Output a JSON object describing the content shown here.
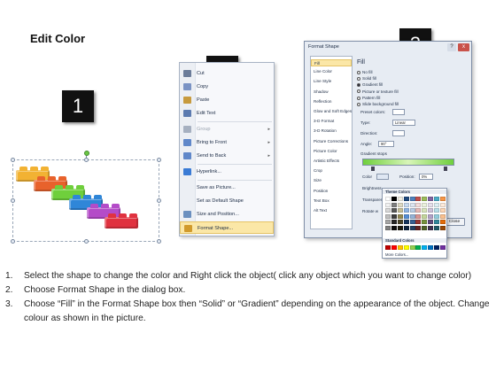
{
  "title": "Edit Color",
  "badges": [
    "1",
    "2",
    "3"
  ],
  "colors": {
    "bricks": [
      "#f2b233",
      "#e8622c",
      "#6fcf3c",
      "#2f86d8",
      "#b44cc8",
      "#e0323f"
    ]
  },
  "context_menu": {
    "items": [
      {
        "label": "Cut",
        "icon": "scissors-icon",
        "disabled": false
      },
      {
        "label": "Copy",
        "icon": "copy-icon",
        "disabled": false
      },
      {
        "label": "Paste",
        "icon": "paste-icon",
        "disabled": false
      },
      {
        "label": "Edit Text",
        "icon": "edit-text-icon",
        "disabled": false
      },
      {
        "label": "Group",
        "icon": "group-icon",
        "disabled": true,
        "submenu": true
      },
      {
        "label": "Bring to Front",
        "icon": "bring-front-icon",
        "disabled": false,
        "submenu": true
      },
      {
        "label": "Send to Back",
        "icon": "send-back-icon",
        "disabled": false,
        "submenu": true
      },
      {
        "label": "Hyperlink...",
        "icon": "hyperlink-icon",
        "disabled": false
      },
      {
        "label": "Save as Picture...",
        "icon": "",
        "disabled": false
      },
      {
        "label": "Set as Default Shape",
        "icon": "",
        "disabled": false
      },
      {
        "label": "Size and Position...",
        "icon": "size-icon",
        "disabled": false
      },
      {
        "label": "Format Shape...",
        "icon": "format-icon",
        "disabled": false,
        "highlighted": true
      }
    ]
  },
  "dialog": {
    "title": "Format Shape",
    "close": "x",
    "help": "?",
    "left_items": [
      "Fill",
      "Line Color",
      "Line Style",
      "Shadow",
      "Reflection",
      "Glow and Soft Edges",
      "3-D Format",
      "3-D Rotation",
      "Picture Corrections",
      "Picture Color",
      "Artistic Effects",
      "Crop",
      "Size",
      "Position",
      "Text Box",
      "Alt Text"
    ],
    "fill_heading": "Fill",
    "options": [
      "No fill",
      "Solid fill",
      "Gradient fill",
      "Picture or texture fill",
      "Pattern fill",
      "Slide background fill"
    ],
    "selected_option": "Gradient fill",
    "preset_label": "Preset colors:",
    "type_label": "Type:",
    "type_value": "Linear",
    "direction_label": "Direction:",
    "angle_label": "Angle:",
    "angle_value": "90°",
    "stops_label": "Gradient stops",
    "color_label": "Color",
    "position_label": "Position:",
    "position_value": "0%",
    "brightness_label": "Brightness",
    "transparency_label": "Transparen",
    "rotate_label": "Rotate w",
    "close_button": "Close"
  },
  "palette": {
    "theme_heading": "Theme Colors",
    "standard_heading": "Standard Colors",
    "more": "More Colors...",
    "theme_top": [
      "#ffffff",
      "#000000",
      "#eeece1",
      "#1f497d",
      "#4f81bd",
      "#c0504d",
      "#9bbb59",
      "#8064a2",
      "#4bacc6",
      "#f79646"
    ],
    "theme_shades": [
      [
        "#f2f2f2",
        "#7f7f7f",
        "#ddd9c3",
        "#c6d9f0",
        "#dbe5f1",
        "#f2dcdb",
        "#ebf1dd",
        "#e5e0ec",
        "#dbeef3",
        "#fdeada"
      ],
      [
        "#d8d8d8",
        "#595959",
        "#c4bd97",
        "#8db3e2",
        "#b8cce4",
        "#e5b9b7",
        "#d7e3bc",
        "#ccc1d9",
        "#b7dde8",
        "#fbd5b5"
      ],
      [
        "#bfbfbf",
        "#3f3f3f",
        "#938953",
        "#548dd4",
        "#95b3d7",
        "#d99694",
        "#c3d69b",
        "#b2a2c7",
        "#92cddc",
        "#fac08f"
      ],
      [
        "#a5a5a5",
        "#262626",
        "#494429",
        "#17365d",
        "#366092",
        "#953734",
        "#76923c",
        "#5f497a",
        "#31859b",
        "#e36c09"
      ],
      [
        "#7f7f7f",
        "#0c0c0c",
        "#1d1b10",
        "#0f243e",
        "#244061",
        "#632423",
        "#4f6128",
        "#3f3151",
        "#205867",
        "#974806"
      ]
    ],
    "standard": [
      "#c00000",
      "#ff0000",
      "#ffc000",
      "#ffff00",
      "#92d050",
      "#00b050",
      "#00b0f0",
      "#0070c0",
      "#002060",
      "#7030a0"
    ]
  },
  "steps": [
    {
      "no": "1.",
      "text": "Select the shape to change the color and Right click the object( click any object which you want to change color)"
    },
    {
      "no": "2.",
      "text": "Choose Format Shape in the dialog box."
    },
    {
      "no": "3.",
      "text": "Choose “Fill” in the Format Shape box then “Solid” or “Gradient” depending on the appearance of the object. Change colour as shown in the picture."
    }
  ]
}
